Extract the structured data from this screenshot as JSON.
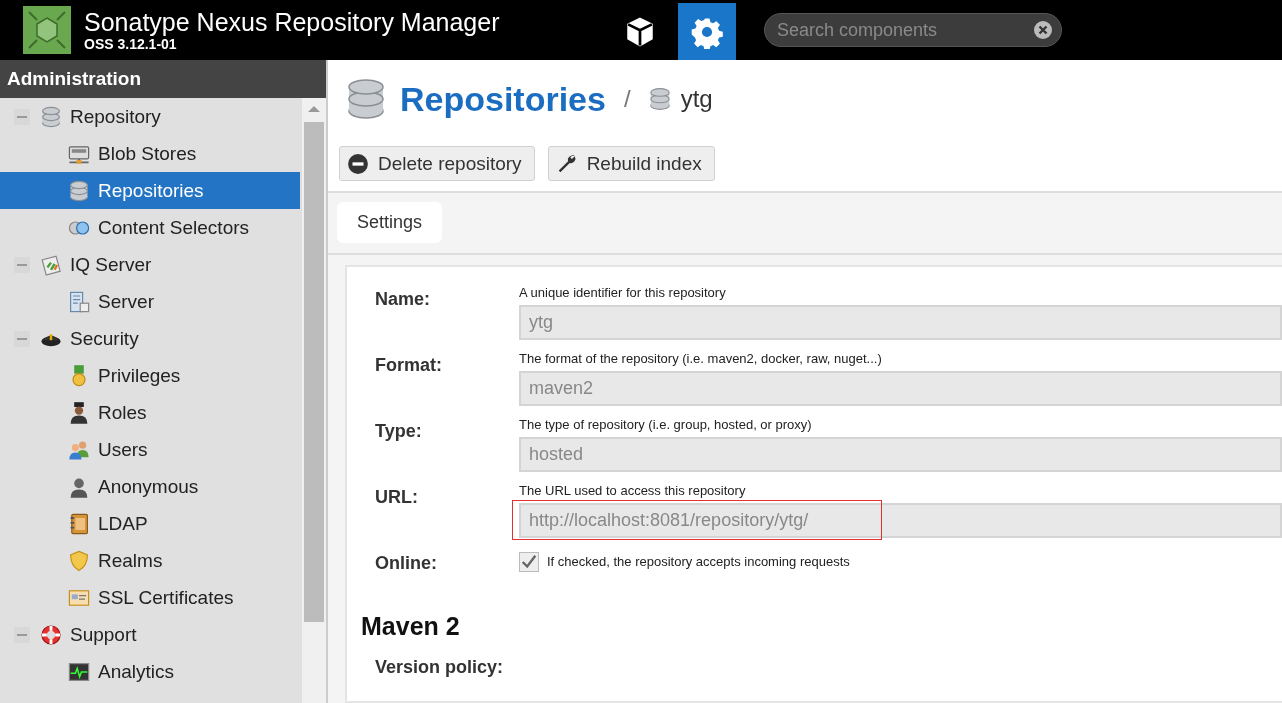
{
  "header": {
    "title": "Sonatype Nexus Repository Manager",
    "version": "OSS 3.12.1-01",
    "modes": [
      {
        "kind": "browse",
        "selected": false
      },
      {
        "kind": "admin",
        "selected": true
      }
    ],
    "search": {
      "placeholder": "Search components"
    }
  },
  "sidebar": {
    "title": "Administration",
    "items": [
      {
        "label": "Repository",
        "expanded": true,
        "selected": false,
        "children": [
          {
            "label": "Blob Stores",
            "selected": false
          },
          {
            "label": "Repositories",
            "selected": true
          },
          {
            "label": "Content Selectors",
            "selected": false
          }
        ]
      },
      {
        "label": "IQ Server",
        "expanded": true,
        "selected": false,
        "children": [
          {
            "label": "Server",
            "selected": false
          }
        ]
      },
      {
        "label": "Security",
        "expanded": true,
        "selected": false,
        "children": [
          {
            "label": "Privileges",
            "selected": false
          },
          {
            "label": "Roles",
            "selected": false
          },
          {
            "label": "Users",
            "selected": false
          },
          {
            "label": "Anonymous",
            "selected": false
          },
          {
            "label": "LDAP",
            "selected": false
          },
          {
            "label": "Realms",
            "selected": false
          },
          {
            "label": "SSL Certificates",
            "selected": false
          }
        ]
      },
      {
        "label": "Support",
        "expanded": true,
        "selected": false,
        "children": [
          {
            "label": "Analytics",
            "selected": false
          }
        ]
      }
    ]
  },
  "breadcrumb": {
    "title": "Repositories",
    "separator": "/",
    "current": "ytg"
  },
  "actions": [
    {
      "label": "Delete repository",
      "kind": "delete"
    },
    {
      "label": "Rebuild index",
      "kind": "rebuild"
    }
  ],
  "tabs": [
    {
      "label": "Settings",
      "selected": true
    }
  ],
  "form": {
    "fields": [
      {
        "kind": "text",
        "label": "Name:",
        "help": "A unique identifier for this repository",
        "value": "ytg",
        "highlighted": false
      },
      {
        "kind": "text",
        "label": "Format:",
        "help": "The format of the repository (i.e. maven2, docker, raw, nuget...)",
        "value": "maven2",
        "highlighted": false
      },
      {
        "kind": "text",
        "label": "Type:",
        "help": "The type of repository (i.e. group, hosted, or proxy)",
        "value": "hosted",
        "highlighted": false
      },
      {
        "kind": "text",
        "label": "URL:",
        "help": "The URL used to access this repository",
        "value": "http://localhost:8081/repository/ytg/",
        "highlighted": true
      },
      {
        "kind": "checkbox",
        "label": "Online:",
        "help": "If checked, the repository accepts incoming requests",
        "checked": true
      }
    ],
    "section": "Maven 2",
    "next_label": "Version policy:"
  }
}
